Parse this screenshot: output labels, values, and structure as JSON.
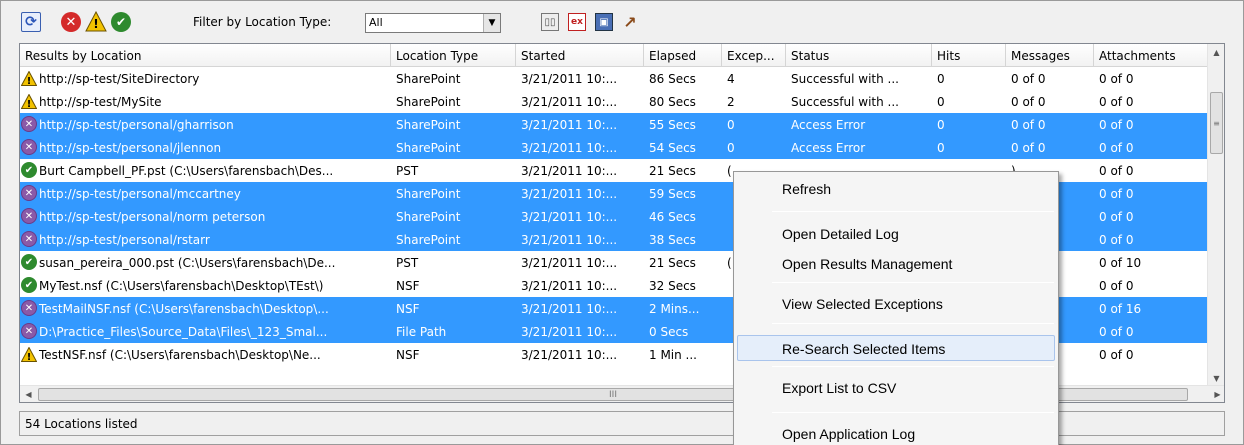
{
  "toolbar": {
    "filter_label": "Filter by Location Type:",
    "filter_value": "All",
    "excel_icon_text": "ex"
  },
  "columns": [
    "Results by Location",
    "Location Type",
    "Started",
    "Elapsed",
    "Excep...",
    "Status",
    "Hits",
    "Messages",
    "Attachments"
  ],
  "rows": [
    {
      "icon": "warning",
      "selected": false,
      "cells": [
        "http://sp-test/SiteDirectory",
        "SharePoint",
        "3/21/2011 10:...",
        "86 Secs",
        "4",
        "Successful with ...",
        "0",
        "0  of 0",
        "0  of 0"
      ]
    },
    {
      "icon": "warning",
      "selected": false,
      "cells": [
        "http://sp-test/MySite",
        "SharePoint",
        "3/21/2011 10:...",
        "80 Secs",
        "2",
        "Successful with ...",
        "0",
        "0  of 0",
        "0  of 0"
      ]
    },
    {
      "icon": "error",
      "selected": true,
      "cells": [
        "http://sp-test/personal/gharrison",
        "SharePoint",
        "3/21/2011 10:...",
        "55 Secs",
        "0",
        "Access Error",
        "0",
        "0  of 0",
        "0  of 0"
      ]
    },
    {
      "icon": "error",
      "selected": true,
      "cells": [
        "http://sp-test/personal/jlennon",
        "SharePoint",
        "3/21/2011 10:...",
        "54 Secs",
        "0",
        "Access Error",
        "0",
        "0  of 0",
        "0  of 0"
      ]
    },
    {
      "icon": "ok",
      "selected": false,
      "cells": [
        "Burt Campbell_PF.pst (C:\\Users\\farensbach\\Des...",
        "PST",
        "3/21/2011 10:...",
        "21 Secs",
        "(",
        "",
        "",
        ")",
        "0  of 0"
      ]
    },
    {
      "icon": "error",
      "selected": true,
      "cells": [
        "http://sp-test/personal/mccartney",
        "SharePoint",
        "3/21/2011 10:...",
        "59 Secs",
        "",
        "",
        "",
        "",
        "0  of 0"
      ]
    },
    {
      "icon": "error",
      "selected": true,
      "cells": [
        "http://sp-test/personal/norm peterson",
        "SharePoint",
        "3/21/2011 10:...",
        "46 Secs",
        "",
        "",
        "",
        "",
        "0  of 0"
      ]
    },
    {
      "icon": "error",
      "selected": true,
      "cells": [
        "http://sp-test/personal/rstarr",
        "SharePoint",
        "3/21/2011 10:...",
        "38 Secs",
        "",
        "",
        "",
        "",
        "0  of 0"
      ]
    },
    {
      "icon": "ok",
      "selected": false,
      "cells": [
        "susan_pereira_000.pst (C:\\Users\\farensbach\\De...",
        "PST",
        "3/21/2011 10:...",
        "21 Secs",
        "(",
        "",
        "",
        "8",
        "0  of 10"
      ]
    },
    {
      "icon": "ok",
      "selected": false,
      "cells": [
        "MyTest.nsf (C:\\Users\\farensbach\\Desktop\\TEst\\)",
        "NSF",
        "3/21/2011 10:...",
        "32 Secs",
        "",
        "",
        "",
        "04",
        "0  of 0"
      ]
    },
    {
      "icon": "error",
      "selected": true,
      "cells": [
        "TestMailNSF.nsf (C:\\Users\\farensbach\\Desktop\\...",
        "NSF",
        "3/21/2011 10:...",
        "2 Mins...",
        "",
        "",
        "",
        "1",
        "0  of 16"
      ]
    },
    {
      "icon": "error",
      "selected": true,
      "cells": [
        "D:\\Practice_Files\\Source_Data\\Files\\_123_Smal...",
        "File Path",
        "3/21/2011 10:...",
        "0 Secs",
        "",
        "",
        "",
        "",
        "0  of 0"
      ]
    },
    {
      "icon": "warning",
      "selected": false,
      "cells": [
        "TestNSF.nsf (C:\\Users\\farensbach\\Desktop\\Ne...",
        "NSF",
        "3/21/2011 10:...",
        "1 Min ...",
        "",
        "",
        "",
        ",312",
        "0  of 0"
      ]
    }
  ],
  "scroll": {
    "hscroll_grip": "III"
  },
  "status": {
    "text": "54 Locations listed"
  },
  "context_menu": {
    "items": [
      {
        "label": "Refresh",
        "highlighted": false
      },
      {
        "label": "Open Detailed Log",
        "highlighted": false
      },
      {
        "label": "Open Results Management",
        "highlighted": false
      },
      {
        "label": "View Selected Exceptions",
        "highlighted": false
      },
      {
        "label": "Re-Search Selected Items",
        "highlighted": true
      },
      {
        "label": "Export List to CSV",
        "highlighted": false
      },
      {
        "label": "Open Application Log",
        "highlighted": false
      }
    ]
  },
  "colors": {
    "selection": "#3399ff",
    "menu_highlight": "#e5eefa",
    "error_icon": "#8a5aa8",
    "ok_icon": "#2e8a2e",
    "warning_icon": "#f2c200"
  }
}
